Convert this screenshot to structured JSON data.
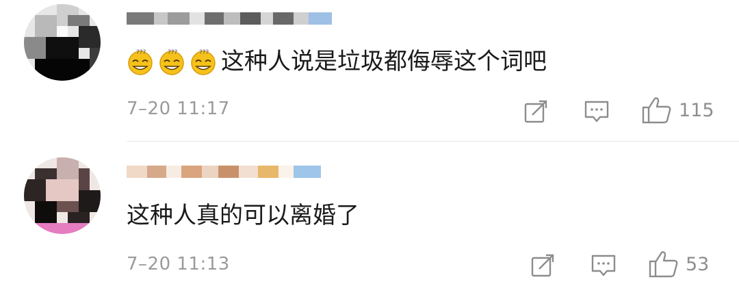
{
  "comments": [
    {
      "username": "",
      "emoji": [
        "dizzy-smile-emoji",
        "dizzy-smile-emoji",
        "dizzy-smile-emoji"
      ],
      "text": "这种人说是垃圾都侮辱这个词吧",
      "time": "7–20 11:17",
      "like_count": "115"
    },
    {
      "username": "",
      "emoji": [],
      "text": "这种人真的可以离婚了",
      "time": "7–20 11:13",
      "like_count": "53"
    }
  ],
  "icons": {
    "share": "share-icon",
    "reply": "reply-icon",
    "like": "thumbs-up-icon"
  },
  "colors": {
    "text": "#1a1a1a",
    "meta": "#9a9a9a",
    "divider": "#e6e6e6",
    "emoji_face": "#f5c21b"
  }
}
